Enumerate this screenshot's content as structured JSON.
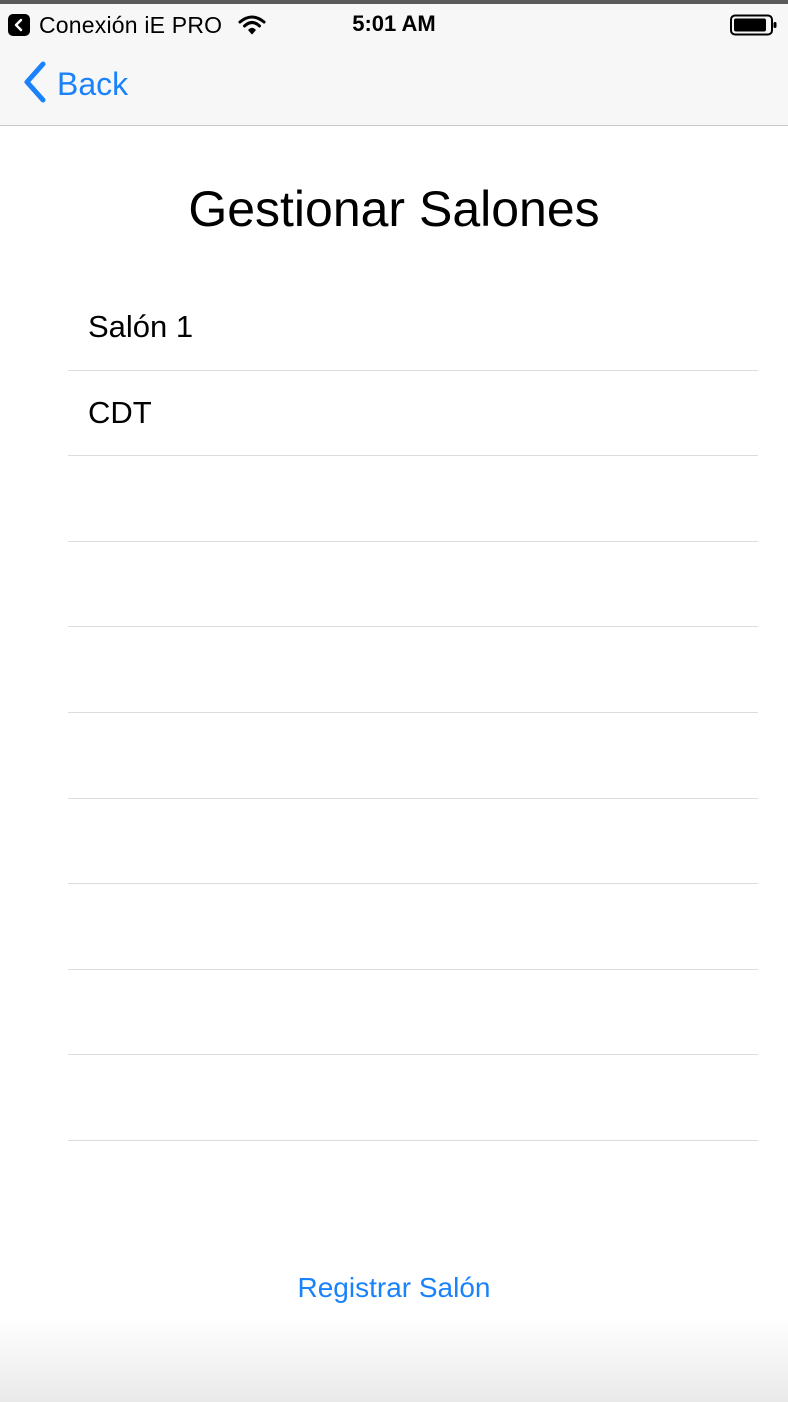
{
  "status_bar": {
    "return_app_label": "Conexión iE PRO",
    "time": "5:01 AM",
    "icons": [
      "back-to-app-icon",
      "wifi-icon",
      "battery-icon"
    ]
  },
  "nav": {
    "back_label": "Back",
    "back_icon": "chevron-left-icon"
  },
  "page": {
    "title": "Gestionar Salones"
  },
  "rooms": [
    {
      "label": "Salón 1"
    },
    {
      "label": "CDT"
    },
    {
      "label": ""
    },
    {
      "label": ""
    },
    {
      "label": ""
    },
    {
      "label": ""
    },
    {
      "label": ""
    },
    {
      "label": ""
    },
    {
      "label": ""
    },
    {
      "label": ""
    }
  ],
  "actions": {
    "register_label": "Registrar Salón"
  },
  "colors": {
    "accent": "#1a82fb",
    "separator": "#dcdcdc",
    "bar_background": "#f7f7f7"
  }
}
